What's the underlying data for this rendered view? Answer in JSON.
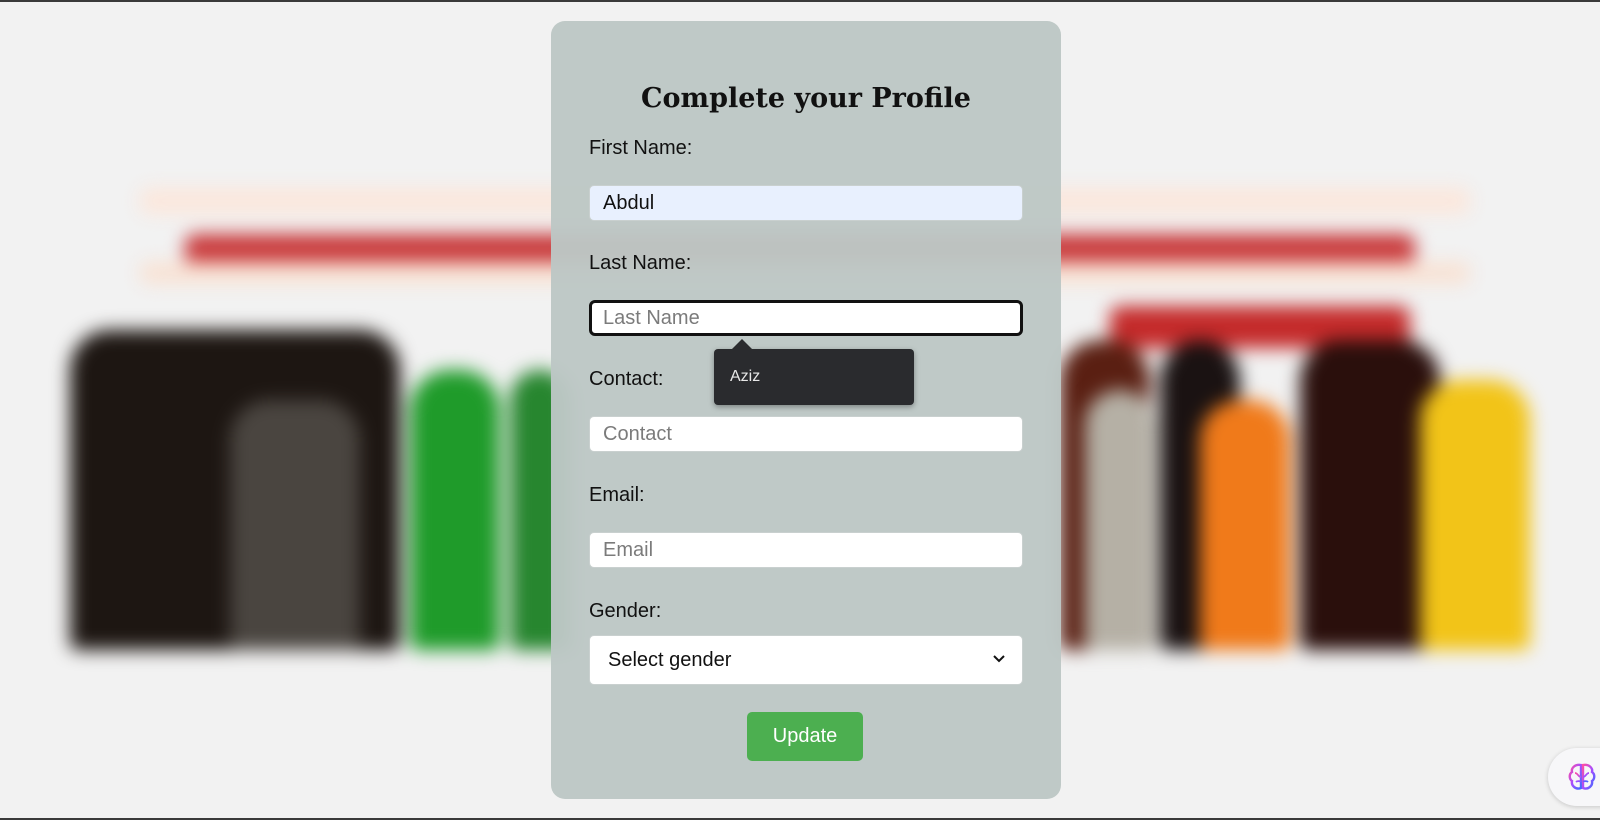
{
  "form": {
    "title": "Complete your Profile",
    "first_name": {
      "label": "First Name:",
      "value": "Abdul"
    },
    "last_name": {
      "label": "Last Name:",
      "value": "",
      "placeholder": "Last Name"
    },
    "contact": {
      "label": "Contact:",
      "value": "",
      "placeholder": "Contact"
    },
    "email": {
      "label": "Email:",
      "value": "",
      "placeholder": "Email"
    },
    "gender": {
      "label": "Gender:",
      "selected": "Select gender"
    },
    "submit_label": "Update"
  },
  "autofill_suggestion": "Aziz",
  "colors": {
    "button": "#4caf50",
    "card": "#bcc7c5",
    "autofill_bg": "#e8f0fe"
  },
  "icons": {
    "select_arrow": "chevron-down-icon",
    "assistant": "brain-icon"
  }
}
